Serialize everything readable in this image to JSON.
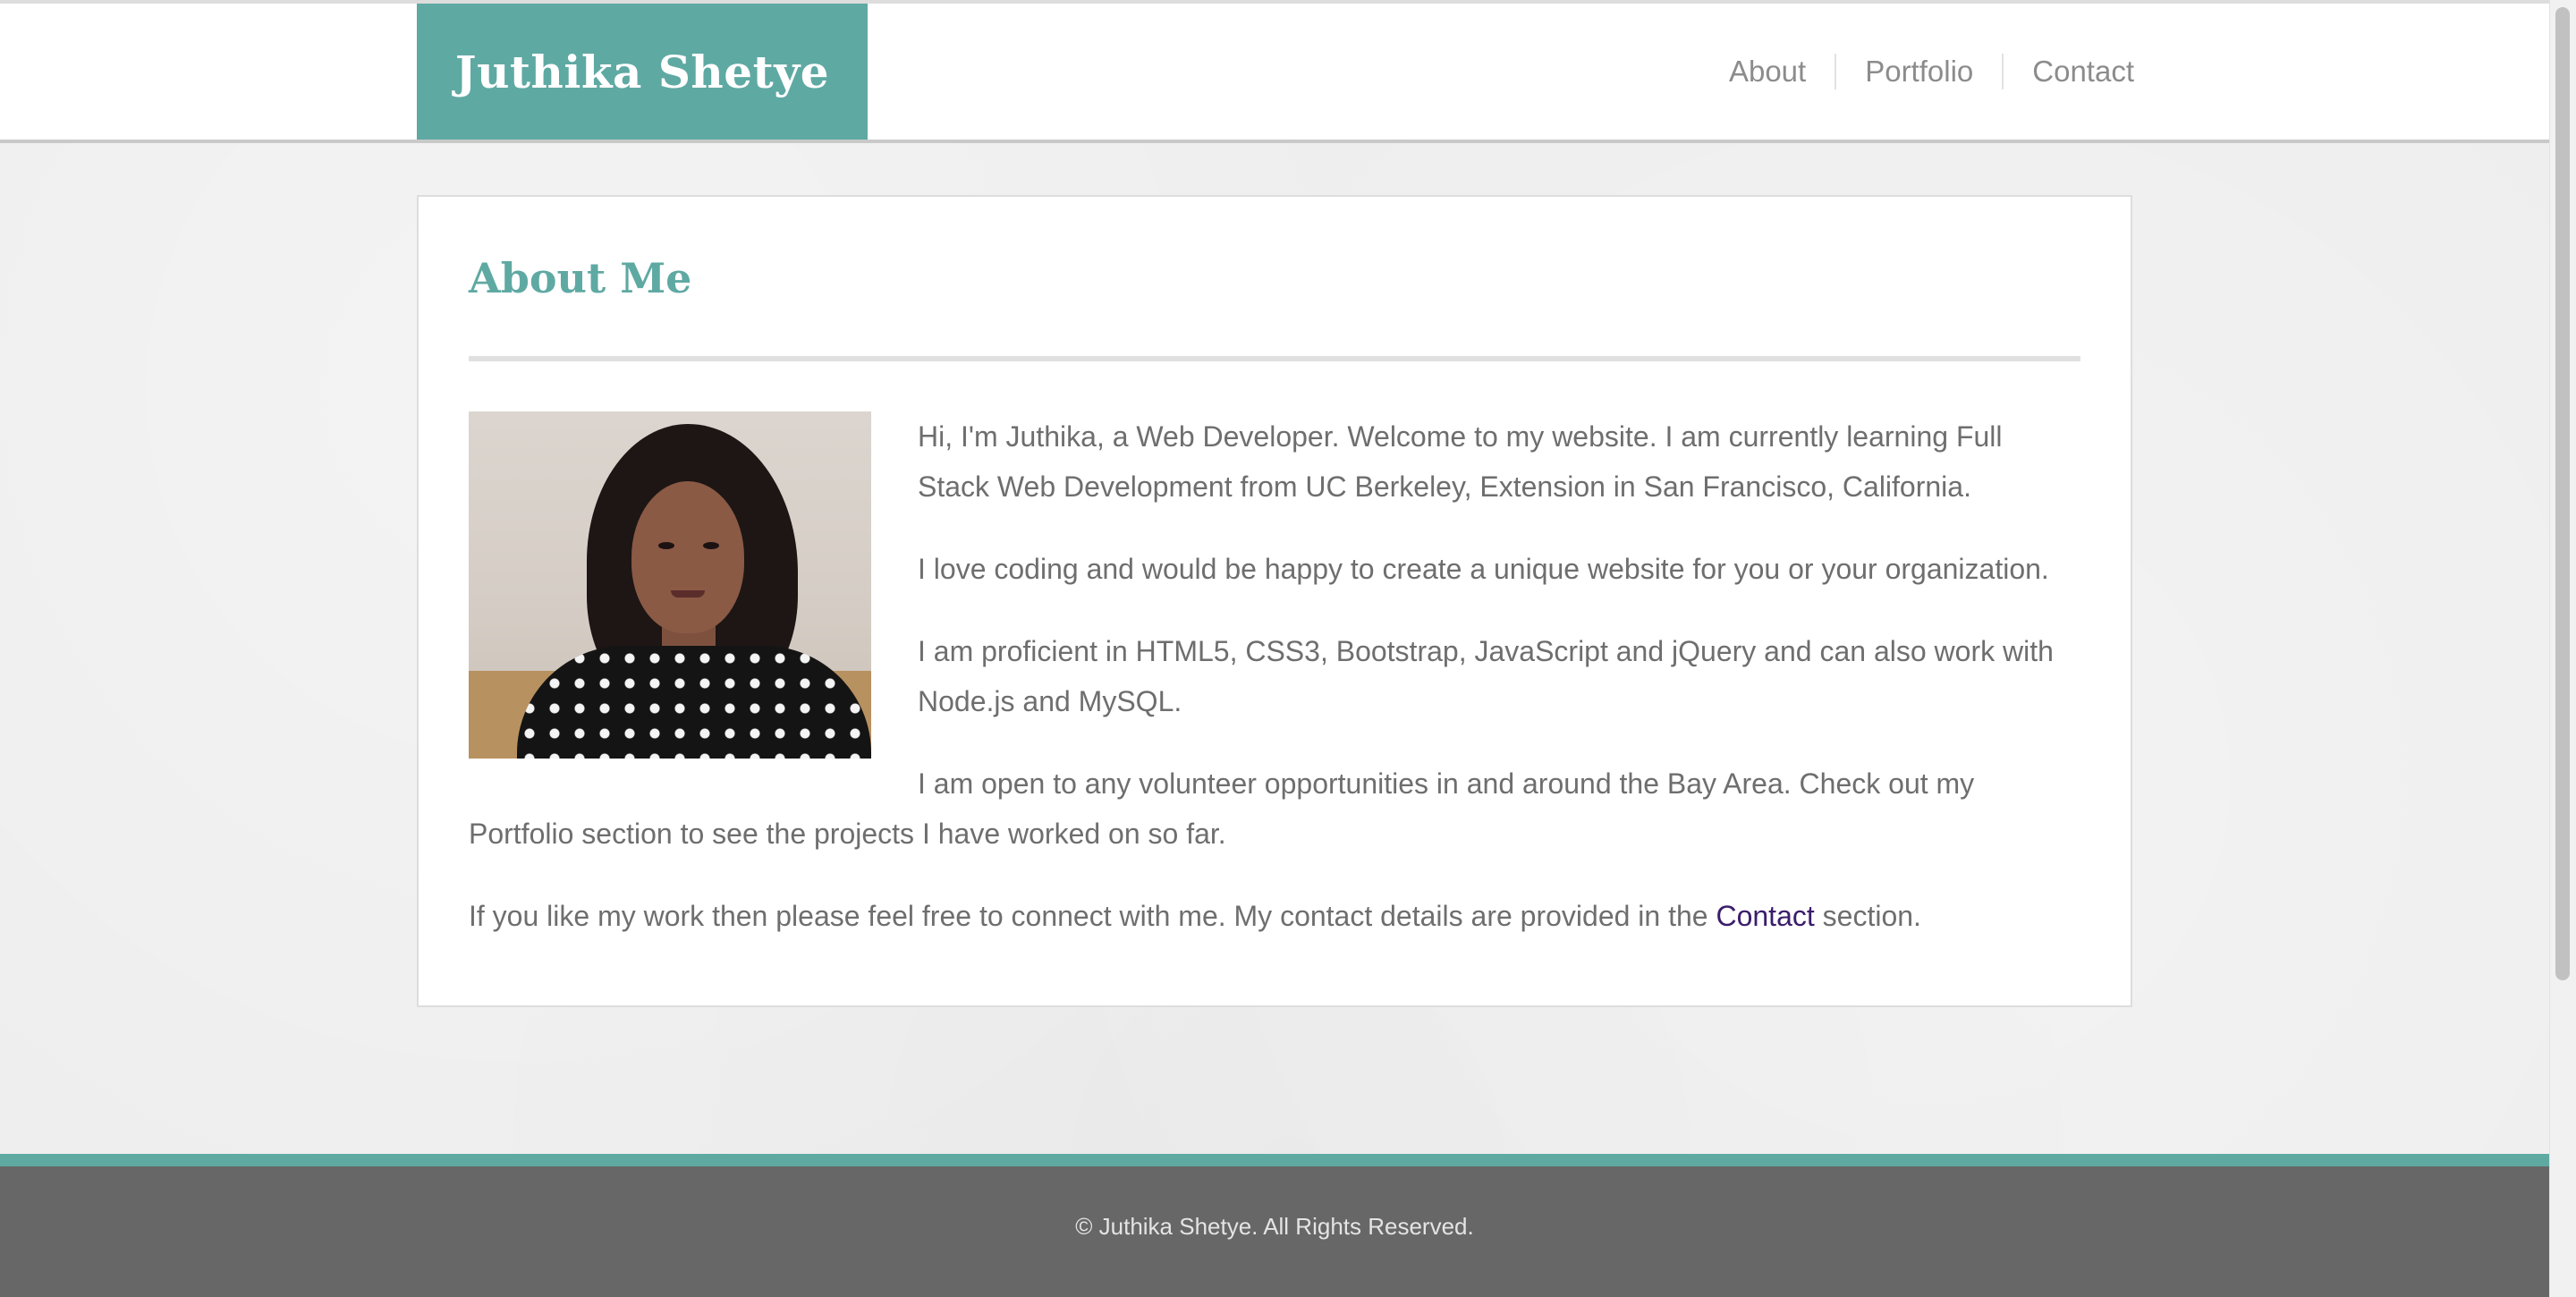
{
  "header": {
    "brand": "Juthika Shetye",
    "nav": [
      {
        "label": "About"
      },
      {
        "label": "Portfolio"
      },
      {
        "label": "Contact"
      }
    ]
  },
  "about": {
    "title": "About Me",
    "photo_alt": "Portrait of Juthika Shetye",
    "paragraphs": [
      "Hi, I'm Juthika, a Web Developer. Welcome to my website. I am currently learning Full Stack Web Development from UC Berkeley, Extension in San Francisco, California.",
      "I love coding and would be happy to create a unique website for you or your organization.",
      "I am proficient in HTML5, CSS3, Bootstrap, JavaScript and jQuery and can also work with Node.js and MySQL.",
      "I am open to any volunteer opportunities in and around the Bay Area. Check out my Portfolio section to see the projects I have worked on so far."
    ],
    "closing": {
      "before": "If you like my work then please feel free to connect with me. My contact details are provided in the ",
      "link": "Contact",
      "after": " section."
    }
  },
  "footer": {
    "text": "© Juthika Shetye. All Rights Reserved."
  },
  "colors": {
    "accent": "#5fa9a3",
    "footer_bg": "#676767",
    "link": "#3b1d6b",
    "text": "#6e6e6e"
  }
}
